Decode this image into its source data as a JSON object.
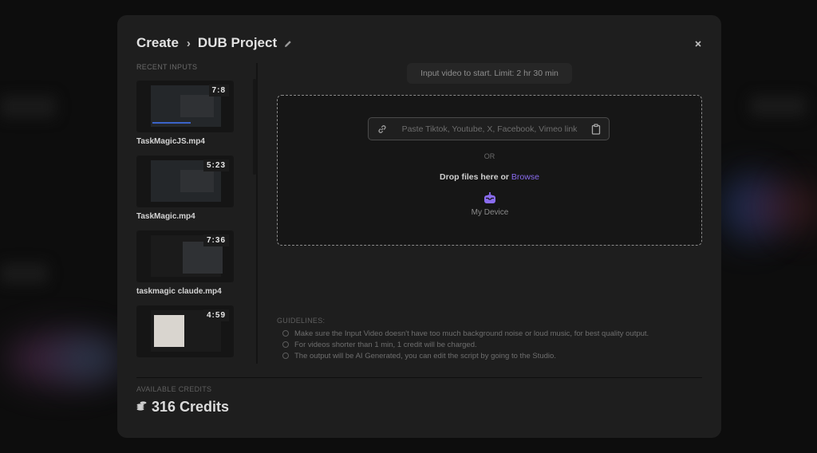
{
  "header": {
    "root": "Create",
    "project": "DUB Project",
    "icons": {
      "separator": "chevron-right-icon",
      "edit": "pencil-icon",
      "close": "close-icon"
    }
  },
  "recent": {
    "label": "RECENT INPUTS",
    "items": [
      {
        "name": "TaskMagicJS.mp4",
        "duration": "7:8",
        "thumb_style": "dark"
      },
      {
        "name": "TaskMagic.mp4",
        "duration": "5:23",
        "thumb_style": "dark"
      },
      {
        "name": "taskmagic claude.mp4",
        "duration": "7:36",
        "thumb_style": "dark"
      },
      {
        "name": "",
        "duration": "4:59",
        "thumb_style": "light"
      }
    ]
  },
  "upload": {
    "limit_text": "Input video to start. Limit:  2 hr 30 min",
    "link_placeholder": "Paste Tiktok, Youtube, X, Facebook, Vimeo link",
    "link_value": "",
    "or_text": "OR",
    "drop_text": "Drop files here or",
    "browse_label": "Browse",
    "device_label": "My Device",
    "accent_color": "#8a6cf0"
  },
  "guidelines": {
    "title": "GUIDELINES:",
    "items": [
      "Make sure the Input Video doesn't have too much background noise or loud music, for best quality output.",
      "For videos shorter than 1 min, 1 credit will be charged.",
      "The output will be AI Generated, you can edit the script by going to the Studio."
    ]
  },
  "credits": {
    "label": "AVAILABLE CREDITS",
    "value": "316 Credits"
  }
}
